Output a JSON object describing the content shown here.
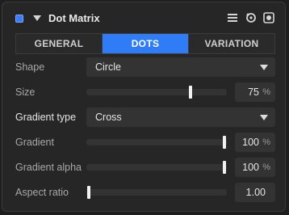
{
  "header": {
    "title": "Dot Matrix",
    "icons": [
      "enable-checkbox-icon",
      "collapse-arrow-icon",
      "menu-icon",
      "reset-icon",
      "record-icon"
    ]
  },
  "tabs": [
    {
      "label": "GENERAL",
      "active": false
    },
    {
      "label": "DOTS",
      "active": true
    },
    {
      "label": "VARIATION",
      "active": false
    }
  ],
  "params": {
    "shape": {
      "label": "Shape",
      "value": "Circle"
    },
    "size": {
      "label": "Size",
      "value": "75",
      "unit": "%",
      "fraction": 0.75
    },
    "gradient_type": {
      "label": "Gradient type",
      "value": "Cross"
    },
    "gradient": {
      "label": "Gradient",
      "value": "100",
      "unit": "%",
      "fraction": 1.0
    },
    "gradient_alpha": {
      "label": "Gradient alpha",
      "value": "100",
      "unit": "%",
      "fraction": 1.0
    },
    "aspect_ratio": {
      "label": "Aspect ratio",
      "value": "1.00",
      "fraction": 0.0
    }
  },
  "colors": {
    "accent": "#2f7cf6",
    "panel": "#262626",
    "control": "#333333"
  }
}
